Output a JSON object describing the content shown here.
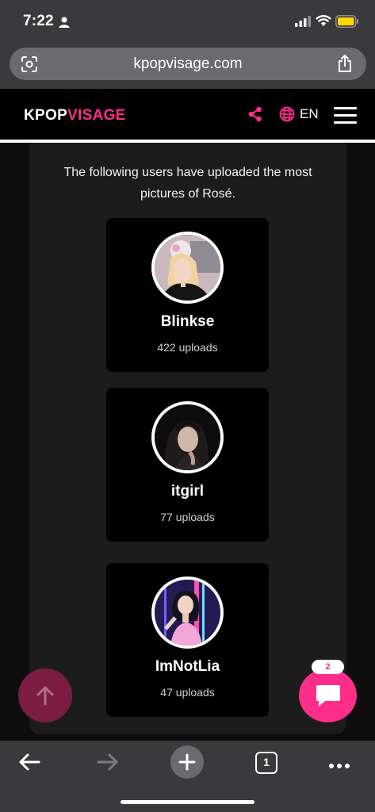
{
  "status_bar": {
    "time": "7:22",
    "icons": [
      "person-icon",
      "signal-icon",
      "wifi-icon",
      "battery-icon"
    ],
    "battery_color": "#ffd60a"
  },
  "browser": {
    "url": "kpopvisage.com",
    "open_tabs": "1"
  },
  "site_header": {
    "logo_part1": "KPOP",
    "logo_part2": "VISAGE",
    "language": "EN",
    "accent_color": "#ff2d8a"
  },
  "main": {
    "intro_text": "The following users have uploaded the most pictures of Rosé.",
    "users": [
      {
        "name": "Blinkse",
        "uploads": "422 uploads"
      },
      {
        "name": "itgirl",
        "uploads": "77 uploads"
      },
      {
        "name": "ImNotLia",
        "uploads": "47 uploads"
      }
    ]
  },
  "chat": {
    "badge_count": "2"
  }
}
